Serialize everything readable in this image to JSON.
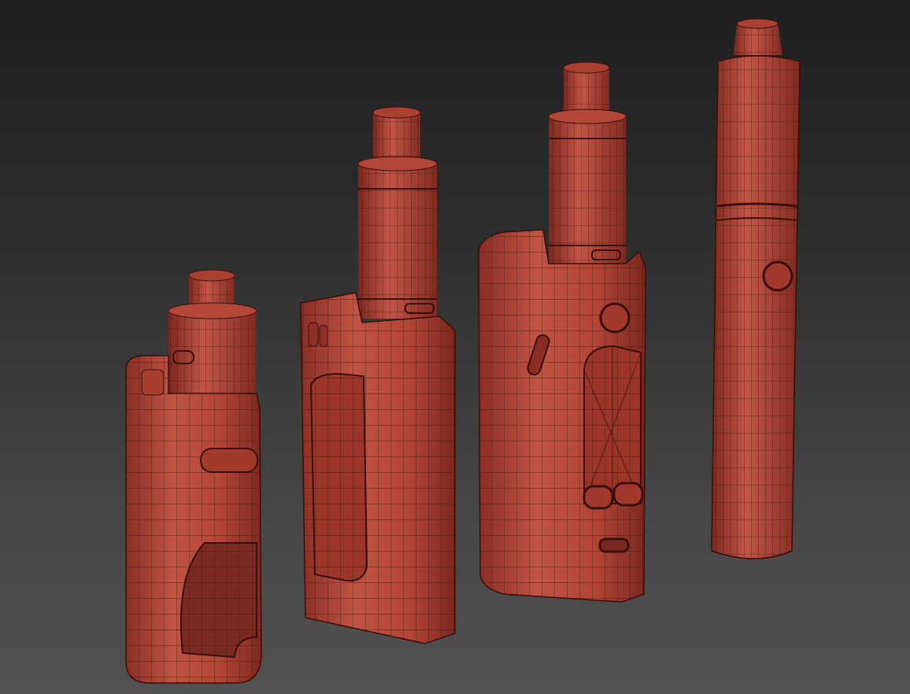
{
  "viewport": {
    "background_top": "#1f1f1f",
    "background_bottom": "#525252"
  },
  "render": {
    "shaded_color": "#b84a3c",
    "shadow_color": "#7a2a22",
    "wire_color": "#3a0e0a",
    "style": "wireframe-over-shaded"
  },
  "objects": [
    {
      "name": "squonk-box-mod-with-tank"
    },
    {
      "name": "box-mod-with-tall-tank"
    },
    {
      "name": "large-box-mod-with-screen"
    },
    {
      "name": "pen-style-vape"
    }
  ]
}
